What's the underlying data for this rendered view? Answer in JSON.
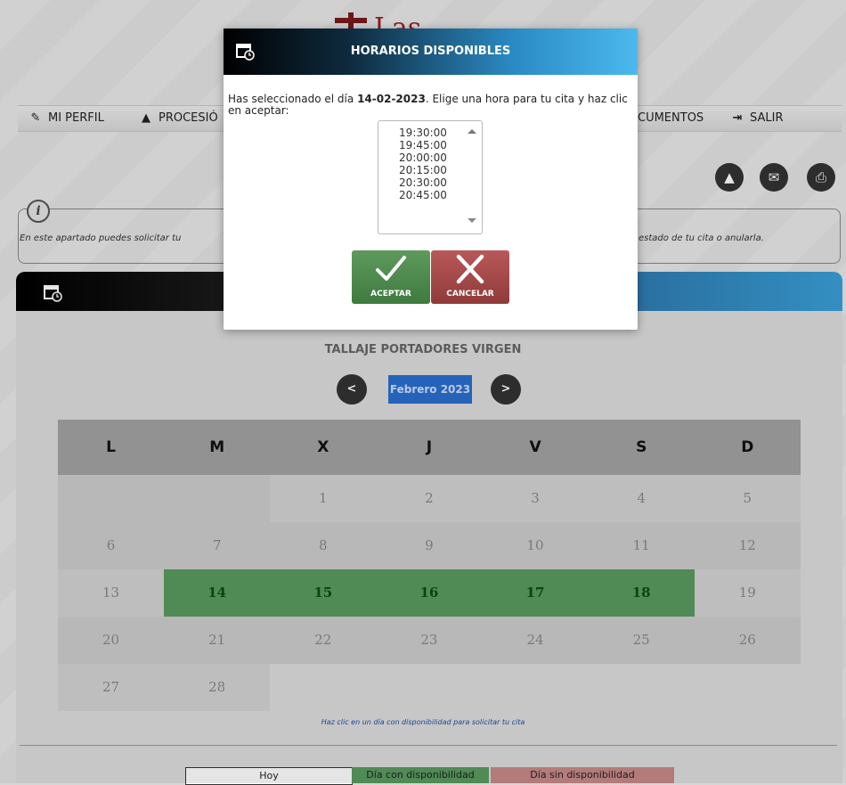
{
  "logo": {
    "text": "Las"
  },
  "menu": [
    {
      "icon": "book-icon",
      "label": "MI PERFIL"
    },
    {
      "icon": "warning-icon",
      "label": "PROCESIÓ"
    },
    {
      "icon": "",
      "label": "CUMENTOS"
    },
    {
      "icon": "logout-icon",
      "label": "SALIR"
    }
  ],
  "toolbar": {
    "icons": [
      "alarm-icon",
      "mail-icon",
      "print-icon"
    ]
  },
  "info": {
    "text_left": "En este apartado puedes solicitar tu",
    "text_right": "estado de tu cita o anularla."
  },
  "calendar": {
    "title": "TALLAJE PORTADORES VIRGEN",
    "prev_label": "<",
    "next_label": ">",
    "month_label": "Febrero 2023",
    "weekdays": [
      "L",
      "M",
      "X",
      "J",
      "V",
      "S",
      "D"
    ],
    "rows": [
      [
        {
          "d": ""
        },
        {
          "d": ""
        },
        {
          "d": "1"
        },
        {
          "d": "2"
        },
        {
          "d": "3"
        },
        {
          "d": "4"
        },
        {
          "d": "5"
        }
      ],
      [
        {
          "d": "6"
        },
        {
          "d": "7"
        },
        {
          "d": "8"
        },
        {
          "d": "9"
        },
        {
          "d": "10"
        },
        {
          "d": "11"
        },
        {
          "d": "12"
        }
      ],
      [
        {
          "d": "13"
        },
        {
          "d": "14",
          "avail": true
        },
        {
          "d": "15",
          "avail": true
        },
        {
          "d": "16",
          "avail": true
        },
        {
          "d": "17",
          "avail": true
        },
        {
          "d": "18",
          "avail": true
        },
        {
          "d": "19"
        }
      ],
      [
        {
          "d": "20"
        },
        {
          "d": "21"
        },
        {
          "d": "22"
        },
        {
          "d": "23"
        },
        {
          "d": "24"
        },
        {
          "d": "25"
        },
        {
          "d": "26"
        }
      ],
      [
        {
          "d": "27"
        },
        {
          "d": "28"
        },
        {
          "d": ""
        },
        {
          "d": ""
        },
        {
          "d": ""
        },
        {
          "d": ""
        },
        {
          "d": ""
        }
      ]
    ],
    "hint": "Haz clic en un día con disponibilidad para solicitar tu cita"
  },
  "legend": {
    "today": "Hoy",
    "available": "Día con disponibilidad",
    "unavailable": "Día sin disponibilidad"
  },
  "colors": {
    "available": "#5a9a5f",
    "unavailable": "#c98a8a",
    "today": "#ffffff",
    "accent": "#2a6fd1"
  },
  "dialog": {
    "title": "HORARIOS DISPONIBLES",
    "msg_prefix": "Has seleccionado el día ",
    "selected_date": "14-02-2023",
    "msg_suffix": ". Elige una hora para tu cita y haz clic en aceptar:",
    "times": [
      "19:30:00",
      "19:45:00",
      "20:00:00",
      "20:15:00",
      "20:30:00",
      "20:45:00"
    ],
    "accept_label": "ACEPTAR",
    "cancel_label": "CANCELAR"
  }
}
